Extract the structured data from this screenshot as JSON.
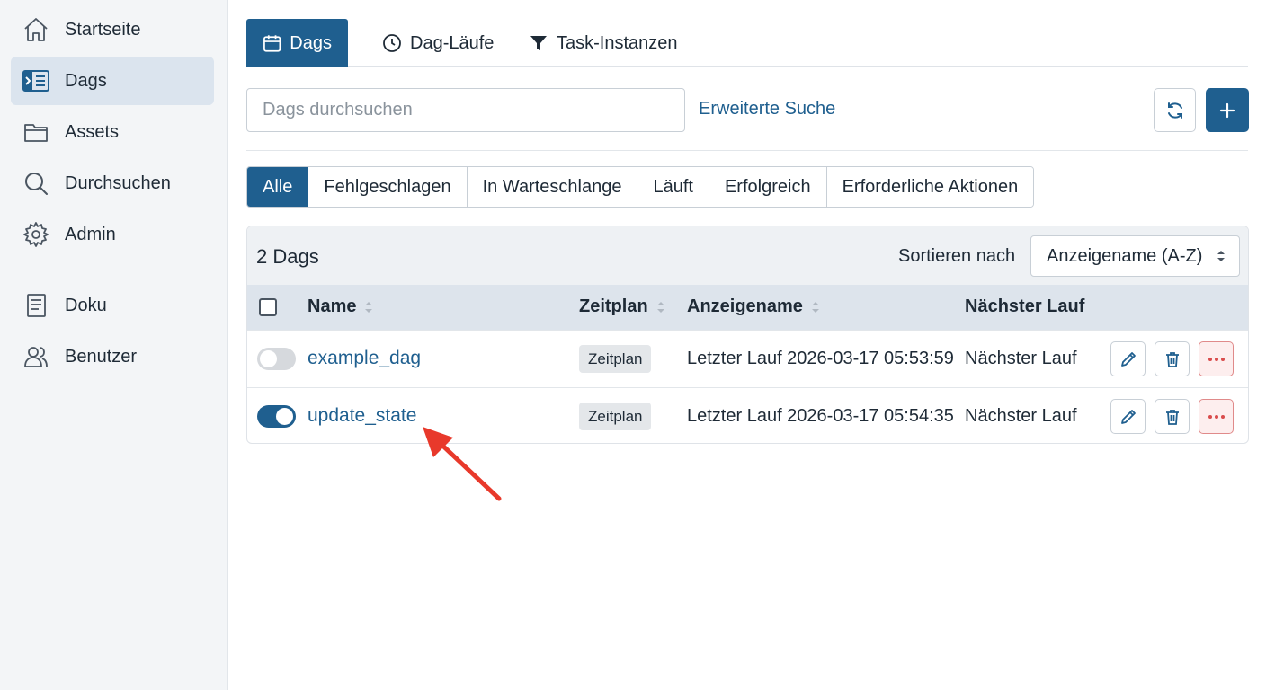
{
  "sidebar": {
    "items": [
      {
        "label": "Startseite",
        "icon": "home-icon"
      },
      {
        "label": "Dags",
        "icon": "dag-list-icon",
        "active": true
      },
      {
        "label": "Assets",
        "icon": "folder-icon"
      },
      {
        "label": "Durchsuchen",
        "icon": "search-icon"
      },
      {
        "label": "Admin",
        "icon": "gear-icon"
      },
      {
        "label": "Doku",
        "icon": "document-icon"
      },
      {
        "label": "Benutzer",
        "icon": "users-icon"
      }
    ]
  },
  "tabs": [
    {
      "label": "Dags",
      "icon": "calendar-icon",
      "active": true
    },
    {
      "label": "Dag-Läufe",
      "icon": "clock-icon"
    },
    {
      "label": "Task-Instanzen",
      "icon": "filter-icon"
    }
  ],
  "search": {
    "placeholder": "Dags durchsuchen",
    "value": ""
  },
  "advanced_search_label": "Erweiterte Suche",
  "filters": [
    {
      "label": "Alle",
      "active": true
    },
    {
      "label": "Fehlgeschlagen"
    },
    {
      "label": "In Warteschlange"
    },
    {
      "label": "Läuft"
    },
    {
      "label": "Erfolgreich"
    },
    {
      "label": "Erforderliche Aktionen"
    }
  ],
  "list": {
    "count_label": "2 Dags",
    "sort_label": "Sortieren nach",
    "sort_value": "Anzeigename (A-Z)",
    "columns": {
      "name": "Name",
      "schedule": "Zeitplan",
      "display_name": "Anzeigename",
      "next_run": "Nächster Lauf"
    },
    "rows": [
      {
        "enabled": false,
        "name": "example_dag",
        "schedule": "Zeitplan",
        "last_run": "Letzter Lauf 2026-03-17 05:53:59",
        "next_run": "Nächster Lauf"
      },
      {
        "enabled": true,
        "name": "update_state",
        "schedule": "Zeitplan",
        "last_run": "Letzter Lauf 2026-03-17 05:54:35",
        "next_run": "Nächster Lauf"
      }
    ]
  },
  "colors": {
    "accent": "#1f5f8f",
    "sidebar_bg": "#f3f5f7",
    "sidebar_active": "#dbe4ee",
    "header_bg": "#eef1f4",
    "table_header_bg": "#dde4ec",
    "danger": "#d94c4c",
    "annotation_arrow": "#e8392b"
  }
}
